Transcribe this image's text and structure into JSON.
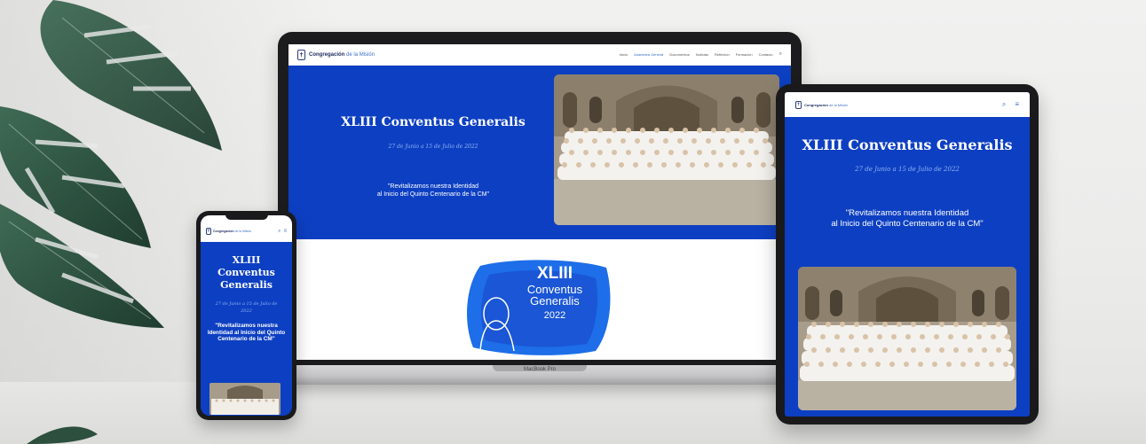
{
  "laptop": {
    "brand_label": "MacBook Pro",
    "site": {
      "logo_main": "Congregación",
      "logo_sub": "de la Misión",
      "nav": [
        "Inicio",
        "Asamblea General",
        "Documentos",
        "Noticias",
        "Reflexión",
        "Formación",
        "Contacto"
      ],
      "hero_title": "XLIII Conventus Generalis",
      "hero_dates": "27 de Junio a 15 de Julio de 2022",
      "hero_quote_line1": "\"Revitalizamos nuestra Identidad",
      "hero_quote_line2": "al Inicio del Quinto Centenario de la CM\"",
      "badge_line1": "XLIII",
      "badge_line2": "Conventus",
      "badge_line3": "Generalis",
      "badge_year": "2022"
    }
  },
  "phone": {
    "title_line1": "XLIII",
    "title_line2": "Conventus",
    "title_line3": "Generalis",
    "dates": "27 de Junio a 15 de Julio de 2022",
    "quote": "\"Revitalizamos nuestra Identidad al Inicio del Quinto Centenario de la CM\""
  },
  "tablet": {
    "title": "XLIII Conventus Generalis",
    "dates": "27 de Junio a 15 de Julio de 2022",
    "quote_line1": "\"Revitalizamos nuestra Identidad",
    "quote_line2": "al Inicio del Quinto Centenario de la CM\""
  },
  "colors": {
    "brand_blue": "#0d3fc2",
    "accent_light_blue": "#8fb4f5",
    "device_frame": "#1a1a1c"
  },
  "icons": [
    "search-icon",
    "menu-icon",
    "cross-logo-icon"
  ]
}
